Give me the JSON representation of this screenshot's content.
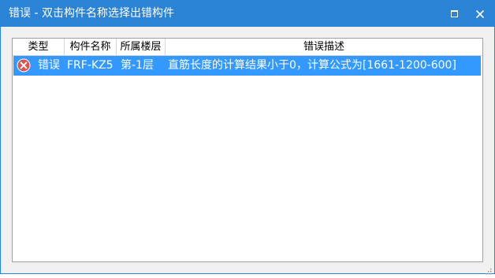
{
  "window": {
    "title": "错误 - 双击构件名称选择出错构件"
  },
  "titlebar_buttons": {
    "maximize_icon": "maximize-icon",
    "close_icon": "close-icon"
  },
  "table": {
    "columns": [
      "类型",
      "构件名称",
      "所属楼层",
      "错误描述"
    ],
    "rows": [
      {
        "icon": "error-circle-icon",
        "type": "错误",
        "component": "FRF-KZ5",
        "floor": "第-1层",
        "description": "直筋长度的计算结果小于0，计算公式为[1661-1200-600]"
      }
    ]
  },
  "colors": {
    "titlebar": "#2b83d6",
    "selection": "#3399ff",
    "error_icon": "#d9534f"
  }
}
